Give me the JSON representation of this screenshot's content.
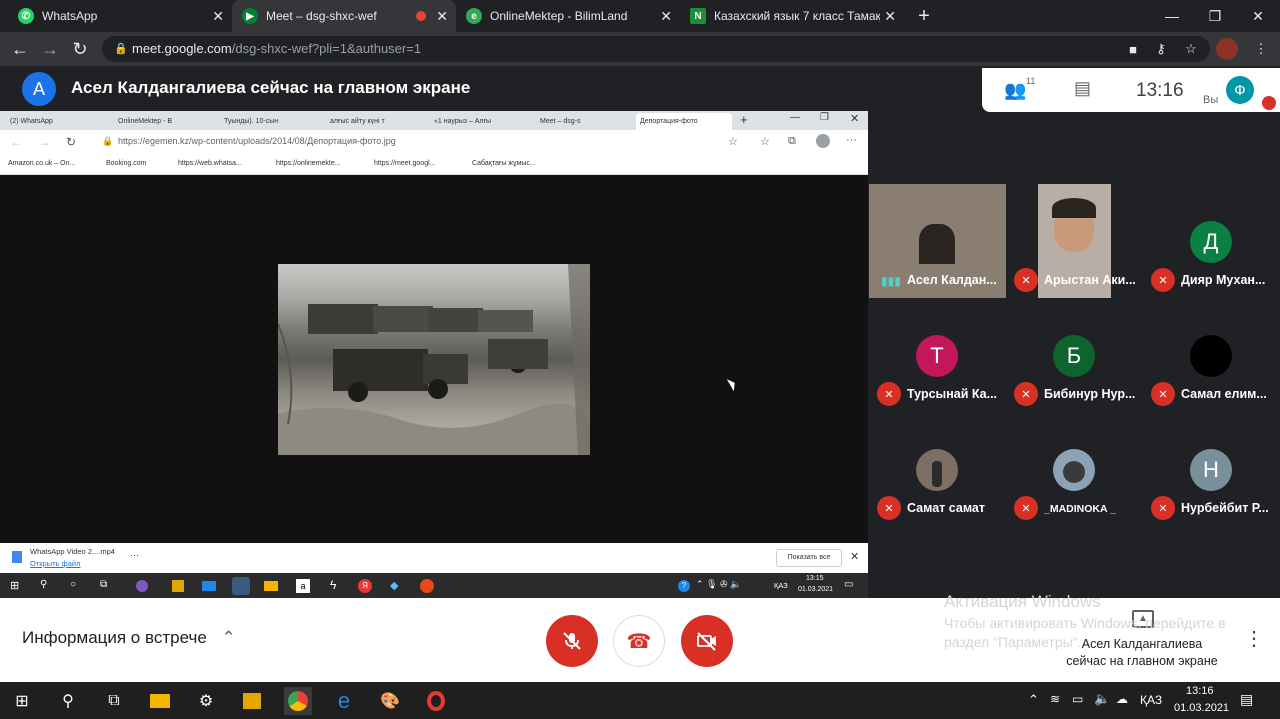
{
  "browser": {
    "tabs": [
      {
        "title": "WhatsApp",
        "icon": "whatsapp-icon"
      },
      {
        "title": "Meet – dsg-shxc-wef",
        "icon": "meet-icon"
      },
      {
        "title": "OnlineMektep - BilimLand",
        "icon": "onlinemektep-icon"
      },
      {
        "title": "Казахский язык 7 класс Тамақта",
        "icon": "n-icon"
      }
    ],
    "url_host": "meet.google.com",
    "url_path": "/dsg-shxc-wef?pli=1&authuser=1"
  },
  "meet": {
    "presenter_initial": "A",
    "presenter_banner": "Асел Калдангалиева сейчас на главном экране",
    "participant_count": "11",
    "time": "13:16",
    "you_label": "Вы",
    "self_initial": "Ф",
    "meeting_info": "Информация о встрече",
    "presenting_text": "Асел Калдангалиева сейчас на главном экране",
    "watermark_title": "Активация Windows",
    "watermark_text": "Чтобы активировать Windows, перейдите в раздел \"Параметры\"."
  },
  "shared_screen": {
    "tabs": [
      "(2) WhatsApp",
      "OnlineMektep - B",
      "Туынды). 10-сын",
      "алғыс айту күні т",
      "«1 наурыз – Алғы",
      "Meet – dsg-s",
      "Депортация-фото"
    ],
    "url": "https://egemen.kz/wp-content/uploads/2014/08/Депортация-фото.jpg",
    "bookmarks": [
      "Amazon.co.uk – On...",
      "Booking.com",
      "https://web.whatsa...",
      "https://onlinemekte...",
      "https://meet.googl...",
      "Сабақтағы жұмыс..."
    ],
    "download_name": "WhatsApp Video 2....mp4",
    "download_link": "Открыть файл",
    "show_all": "Показать все",
    "taskbar_lang": "ҚАЗ",
    "taskbar_time": "13:15",
    "taskbar_date": "01.03.2021"
  },
  "participants": [
    {
      "name": "Асел Калдан...",
      "type": "video",
      "bg": "#8a7e72",
      "muted": false
    },
    {
      "name": "Арыстан Аки...",
      "type": "video",
      "bg": "#9a8f88",
      "muted": true
    },
    {
      "name": "Дияр Мухан...",
      "initial": "Д",
      "color": "#0b8043",
      "muted": true
    },
    {
      "name": "Турсынай Ка...",
      "initial": "Т",
      "color": "#c2185b",
      "muted": true
    },
    {
      "name": "Бибинур Нур...",
      "initial": "Б",
      "color": "#0d652d",
      "muted": true
    },
    {
      "name": "Самал елим...",
      "initial": "",
      "color": "#000000",
      "muted": true
    },
    {
      "name": "Самат самат",
      "initial": "",
      "color": "#7d6f64",
      "muted": true
    },
    {
      "name": "_MADINOKA _",
      "initial": "",
      "color": "#8ca3b5",
      "muted": true
    },
    {
      "name": "Нурбейбит Р...",
      "initial": "Н",
      "color": "#78909c",
      "muted": true
    }
  ],
  "taskbar": {
    "lang": "ҚАЗ",
    "time": "13:16",
    "date": "01.03.2021"
  }
}
